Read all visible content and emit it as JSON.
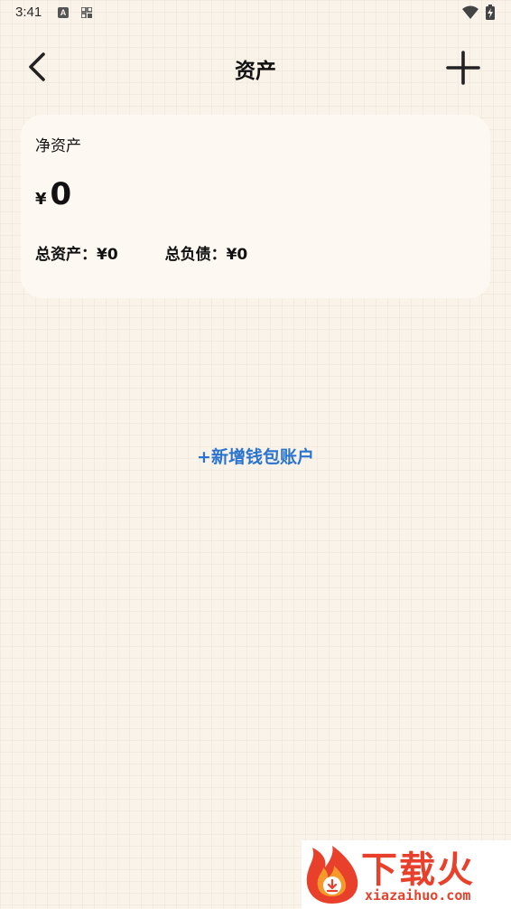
{
  "status_bar": {
    "time": "3:41",
    "icons": [
      "a-notification-icon",
      "grid-notification-icon",
      "wifi-icon",
      "battery-charging-icon"
    ]
  },
  "header": {
    "title": "资产",
    "back_icon": "chevron-left-icon",
    "add_icon": "plus-icon"
  },
  "card": {
    "net_label": "净资产",
    "currency": "¥",
    "net_value": "0",
    "total_assets": "总资产：¥0",
    "total_liabilities": "总负债：¥0"
  },
  "actions": {
    "add_wallet": "+新增钱包账户"
  },
  "watermark": {
    "text": "下载火",
    "url": "xiazaihuo.com"
  },
  "colors": {
    "background": "#faf3ea",
    "card": "#fdf8f1",
    "link": "#2a74d0",
    "watermark": "#e8402a"
  }
}
